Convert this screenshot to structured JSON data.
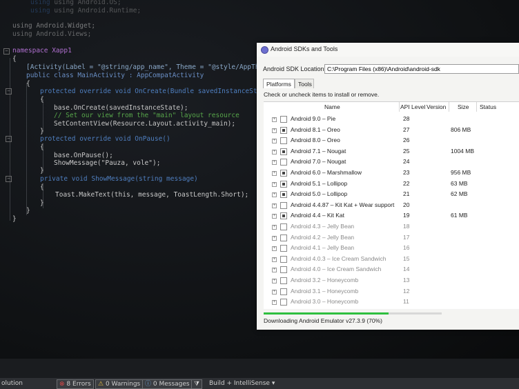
{
  "editor": {
    "lines": [
      {
        "text": "using Android.OS;"
      },
      {
        "text": "using Android.Runtime;"
      },
      {
        "text": "using Android.Widget;"
      },
      {
        "text": "using Android.Views;"
      },
      {
        "text": "namespace Xapp1"
      },
      {
        "text": "{"
      },
      {
        "text": "[Activity(Label = \"@string/app_name\", Theme = \"@style/AppTheme\","
      },
      {
        "text": "public class MainActivity : AppCompatActivity"
      },
      {
        "text": "{"
      },
      {
        "text": "protected override void OnCreate(Bundle savedInstanceState)"
      },
      {
        "text": "{"
      },
      {
        "text": "base.OnCreate(savedInstanceState);"
      },
      {
        "text": "// Set our view from the \"main\" layout resource"
      },
      {
        "text": "SetContentView(Resource.Layout.activity_main);"
      },
      {
        "text": "}"
      },
      {
        "text": "protected override void OnPause()"
      },
      {
        "text": "{"
      },
      {
        "text": "base.OnPause();"
      },
      {
        "text": "ShowMessage(\"Pauza, vole\");"
      },
      {
        "text": "}"
      },
      {
        "text": "private void ShowMessage(string message)"
      },
      {
        "text": "{"
      },
      {
        "text": "Toast.MakeText(this, message, ToastLength.Short);"
      },
      {
        "text": "}"
      },
      {
        "text": "}"
      },
      {
        "text": "}"
      }
    ]
  },
  "statusbar": {
    "solution": "olution",
    "errors": "8 Errors",
    "warnings": "0 Warnings",
    "messages": "0 Messages",
    "build": "Build + IntelliSense"
  },
  "dialog": {
    "title": "Android SDKs and Tools",
    "sdk_location_label": "Android SDK Location:",
    "sdk_location_value": "C:\\Program Files (x86)\\Android\\android-sdk",
    "tabs": [
      "Platforms",
      "Tools"
    ],
    "hint": "Check or uncheck items to install or remove.",
    "columns": [
      "Name",
      "API Level",
      "Version",
      "Size",
      "Status"
    ],
    "rows": [
      {
        "name": "Android 9.0 – Pie",
        "api": "28",
        "size": "",
        "checked": false,
        "faded": false
      },
      {
        "name": "Android 8.1 – Oreo",
        "api": "27",
        "size": "806 MB",
        "checked": true,
        "faded": false
      },
      {
        "name": "Android 8.0 – Oreo",
        "api": "26",
        "size": "",
        "checked": false,
        "faded": false
      },
      {
        "name": "Android 7.1 – Nougat",
        "api": "25",
        "size": "1004 MB",
        "checked": true,
        "faded": false
      },
      {
        "name": "Android 7.0 – Nougat",
        "api": "24",
        "size": "",
        "checked": false,
        "faded": false
      },
      {
        "name": "Android 6.0 – Marshmallow",
        "api": "23",
        "size": "956 MB",
        "checked": true,
        "faded": false
      },
      {
        "name": "Android 5.1 – Lollipop",
        "api": "22",
        "size": "63 MB",
        "checked": true,
        "faded": false
      },
      {
        "name": "Android 5.0 – Lollipop",
        "api": "21",
        "size": "62 MB",
        "checked": true,
        "faded": false
      },
      {
        "name": "Android 4.4.87 – Kit Kat + Wear support",
        "api": "20",
        "size": "",
        "checked": false,
        "faded": false
      },
      {
        "name": "Android 4.4 – Kit Kat",
        "api": "19",
        "size": "61 MB",
        "checked": true,
        "faded": false
      },
      {
        "name": "Android 4.3 – Jelly Bean",
        "api": "18",
        "size": "",
        "checked": false,
        "faded": true
      },
      {
        "name": "Android 4.2 – Jelly Bean",
        "api": "17",
        "size": "",
        "checked": false,
        "faded": true
      },
      {
        "name": "Android 4.1 – Jelly Bean",
        "api": "16",
        "size": "",
        "checked": false,
        "faded": true
      },
      {
        "name": "Android 4.0.3 – Ice Cream Sandwich",
        "api": "15",
        "size": "",
        "checked": false,
        "faded": true
      },
      {
        "name": "Android 4.0 – Ice Cream Sandwich",
        "api": "14",
        "size": "",
        "checked": false,
        "faded": true
      },
      {
        "name": "Android 3.2 – Honeycomb",
        "api": "13",
        "size": "",
        "checked": false,
        "faded": true
      },
      {
        "name": "Android 3.1 – Honeycomb",
        "api": "12",
        "size": "",
        "checked": false,
        "faded": true
      },
      {
        "name": "Android 3.0 – Honeycomb",
        "api": "11",
        "size": "",
        "checked": false,
        "faded": true
      }
    ],
    "progress": {
      "fraction": 0.7,
      "text": "Downloading Android Emulator v27.3.9 (70%)"
    }
  },
  "colors": {
    "progress": "#2fbf3f",
    "keyword": "#3f78c8",
    "type": "#3fb9a4"
  },
  "icons": {
    "title": "android-sdk-icon",
    "errors": "error-icon",
    "warnings": "warning-icon",
    "messages": "message-icon"
  }
}
